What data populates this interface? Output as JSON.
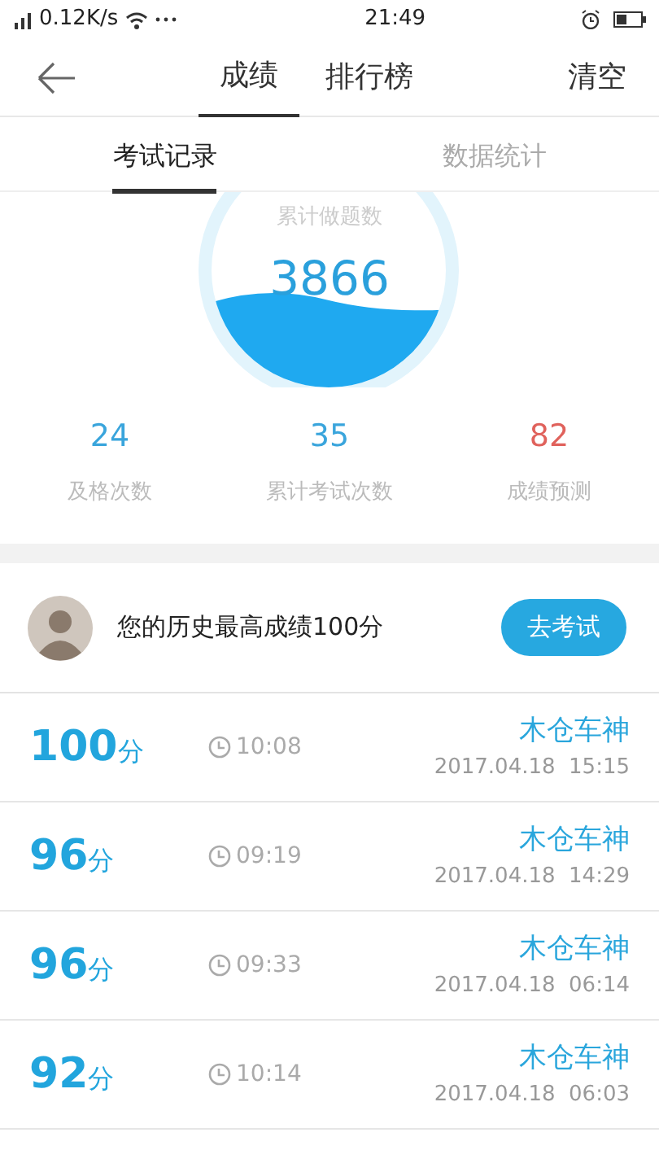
{
  "status_bar": {
    "speed": "0.12K/s",
    "time": "21:49"
  },
  "header": {
    "tabs": [
      {
        "label": "成绩",
        "selected": true
      },
      {
        "label": "排行榜",
        "selected": false
      }
    ],
    "action": "清空"
  },
  "sub_tabs": [
    {
      "label": "考试记录",
      "selected": true
    },
    {
      "label": "数据统计",
      "selected": false
    }
  ],
  "gauge": {
    "label": "累计做题数",
    "value": "3866"
  },
  "stats": [
    {
      "value": "24",
      "label": "及格次数",
      "color": "#3aa5dc"
    },
    {
      "value": "35",
      "label": "累计考试次数",
      "color": "#3aa5dc"
    },
    {
      "value": "82",
      "label": "成绩预测",
      "color": "#e0625c"
    }
  ],
  "best": {
    "text": "您的历史最高成绩100分",
    "button": "去考试"
  },
  "records": [
    {
      "score": "100",
      "unit": "分",
      "duration": "10:08",
      "name": "木仓车神",
      "date": "2017.04.18  15:15"
    },
    {
      "score": "96",
      "unit": "分",
      "duration": "09:19",
      "name": "木仓车神",
      "date": "2017.04.18  14:29"
    },
    {
      "score": "96",
      "unit": "分",
      "duration": "09:33",
      "name": "木仓车神",
      "date": "2017.04.18  06:14"
    },
    {
      "score": "92",
      "unit": "分",
      "duration": "10:14",
      "name": "木仓车神",
      "date": "2017.04.18  06:03"
    }
  ]
}
